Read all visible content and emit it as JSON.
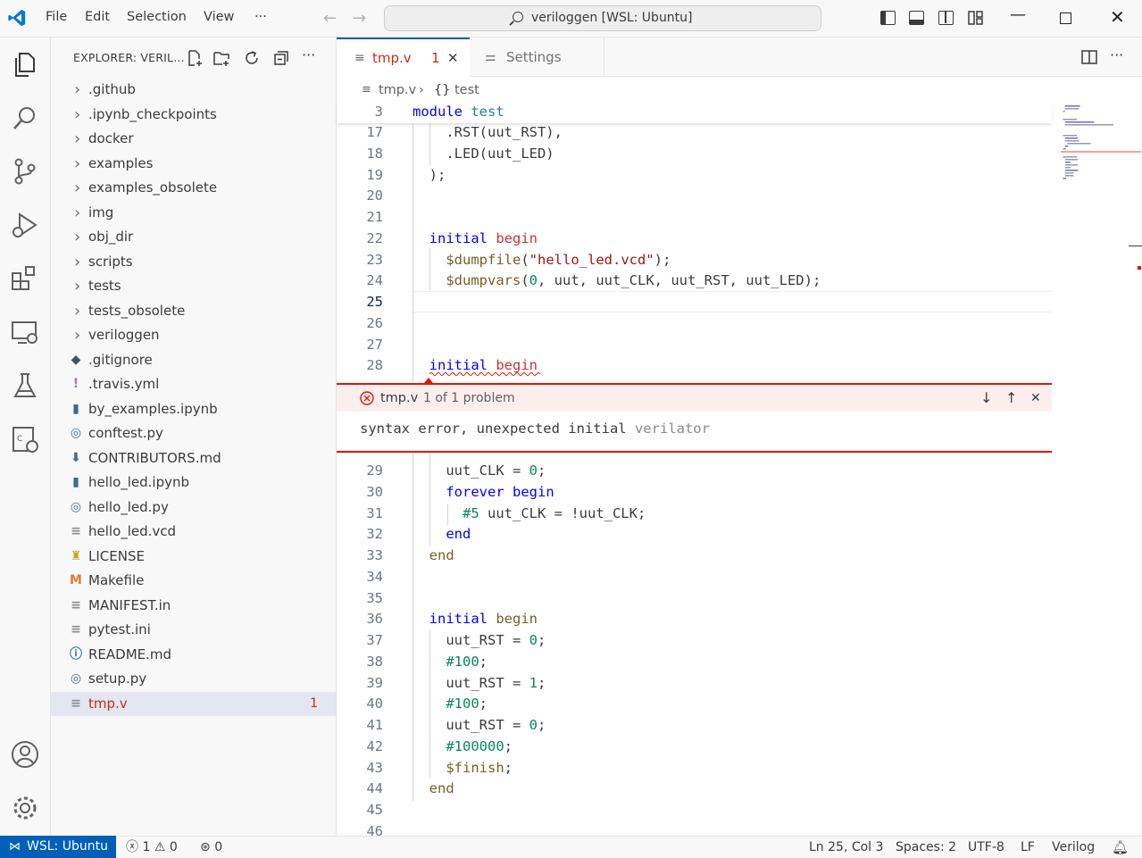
{
  "titlebar": {
    "menus": [
      "File",
      "Edit",
      "Selection",
      "View",
      "···"
    ],
    "search": "veriloggen [WSL: Ubuntu]"
  },
  "sidebar": {
    "title": "EXPLORER: VERIL...",
    "items": [
      {
        "label": ".github",
        "type": "folder"
      },
      {
        "label": ".ipynb_checkpoints",
        "type": "folder"
      },
      {
        "label": "docker",
        "type": "folder"
      },
      {
        "label": "examples",
        "type": "folder"
      },
      {
        "label": "examples_obsolete",
        "type": "folder"
      },
      {
        "label": "img",
        "type": "folder"
      },
      {
        "label": "obj_dir",
        "type": "folder"
      },
      {
        "label": "scripts",
        "type": "folder"
      },
      {
        "label": "tests",
        "type": "folder"
      },
      {
        "label": "tests_obsolete",
        "type": "folder"
      },
      {
        "label": "veriloggen",
        "type": "folder"
      },
      {
        "label": ".gitignore",
        "type": "git"
      },
      {
        "label": ".travis.yml",
        "type": "yml"
      },
      {
        "label": "by_examples.ipynb",
        "type": "notebook"
      },
      {
        "label": "conftest.py",
        "type": "python"
      },
      {
        "label": "CONTRIBUTORS.md",
        "type": "md-down"
      },
      {
        "label": "hello_led.ipynb",
        "type": "notebook"
      },
      {
        "label": "hello_led.py",
        "type": "python"
      },
      {
        "label": "hello_led.vcd",
        "type": "text"
      },
      {
        "label": "LICENSE",
        "type": "license"
      },
      {
        "label": "Makefile",
        "type": "makefile"
      },
      {
        "label": "MANIFEST.in",
        "type": "text"
      },
      {
        "label": "pytest.ini",
        "type": "text"
      },
      {
        "label": "README.md",
        "type": "info"
      },
      {
        "label": "setup.py",
        "type": "python"
      },
      {
        "label": "tmp.v",
        "type": "text",
        "selected": true,
        "problems": "1"
      }
    ]
  },
  "tabs": [
    {
      "label": "tmp.v",
      "badge": "1",
      "active": true
    },
    {
      "label": "Settings",
      "active": false
    }
  ],
  "breadcrumb": {
    "file": "tmp.v",
    "symbol": "test"
  },
  "editor": {
    "sticky": {
      "num": "3",
      "text": "module test"
    },
    "lines_top": [
      {
        "num": "17",
        "text": "    .RST(uut_RST),"
      },
      {
        "num": "18",
        "text": "    .LED(uut_LED)"
      },
      {
        "num": "19",
        "text": "  );"
      },
      {
        "num": "20",
        "text": ""
      },
      {
        "num": "21",
        "text": ""
      },
      {
        "num": "22",
        "text": "  initial begin"
      },
      {
        "num": "23",
        "text": "    $dumpfile(\"hello_led.vcd\");"
      },
      {
        "num": "24",
        "text": "    $dumpvars(0, uut, uut_CLK, uut_RST, uut_LED);"
      },
      {
        "num": "25",
        "text": ""
      },
      {
        "num": "26",
        "text": ""
      },
      {
        "num": "27",
        "text": ""
      },
      {
        "num": "28",
        "text": "  initial begin"
      }
    ],
    "lines_bottom": [
      {
        "num": "29",
        "text": "    uut_CLK = 0;"
      },
      {
        "num": "30",
        "text": "    forever begin"
      },
      {
        "num": "31",
        "text": "      #5 uut_CLK = !uut_CLK;"
      },
      {
        "num": "32",
        "text": "    end"
      },
      {
        "num": "33",
        "text": "  end"
      },
      {
        "num": "34",
        "text": ""
      },
      {
        "num": "35",
        "text": ""
      },
      {
        "num": "36",
        "text": "  initial begin"
      },
      {
        "num": "37",
        "text": "    uut_RST = 0;"
      },
      {
        "num": "38",
        "text": "    #100;"
      },
      {
        "num": "39",
        "text": "    uut_RST = 1;"
      },
      {
        "num": "40",
        "text": "    #100;"
      },
      {
        "num": "41",
        "text": "    uut_RST = 0;"
      },
      {
        "num": "42",
        "text": "    #100000;"
      },
      {
        "num": "43",
        "text": "    $finish;"
      },
      {
        "num": "44",
        "text": "  end"
      },
      {
        "num": "45",
        "text": ""
      },
      {
        "num": "46",
        "text": ""
      }
    ]
  },
  "peek": {
    "file": "tmp.v",
    "count": "1 of 1 problem",
    "message": "syntax error, unexpected initial",
    "source": "verilator"
  },
  "statusbar": {
    "remote": "WSL: Ubuntu",
    "errors": "1",
    "warnings": "0",
    "ports": "0",
    "position": "Ln 25, Col 3",
    "spaces": "Spaces: 2",
    "encoding": "UTF-8",
    "eol": "LF",
    "language": "Verilog"
  },
  "colors": {
    "accent": "#005fb8",
    "error": "#e51400",
    "keyword": "#0000ff"
  }
}
